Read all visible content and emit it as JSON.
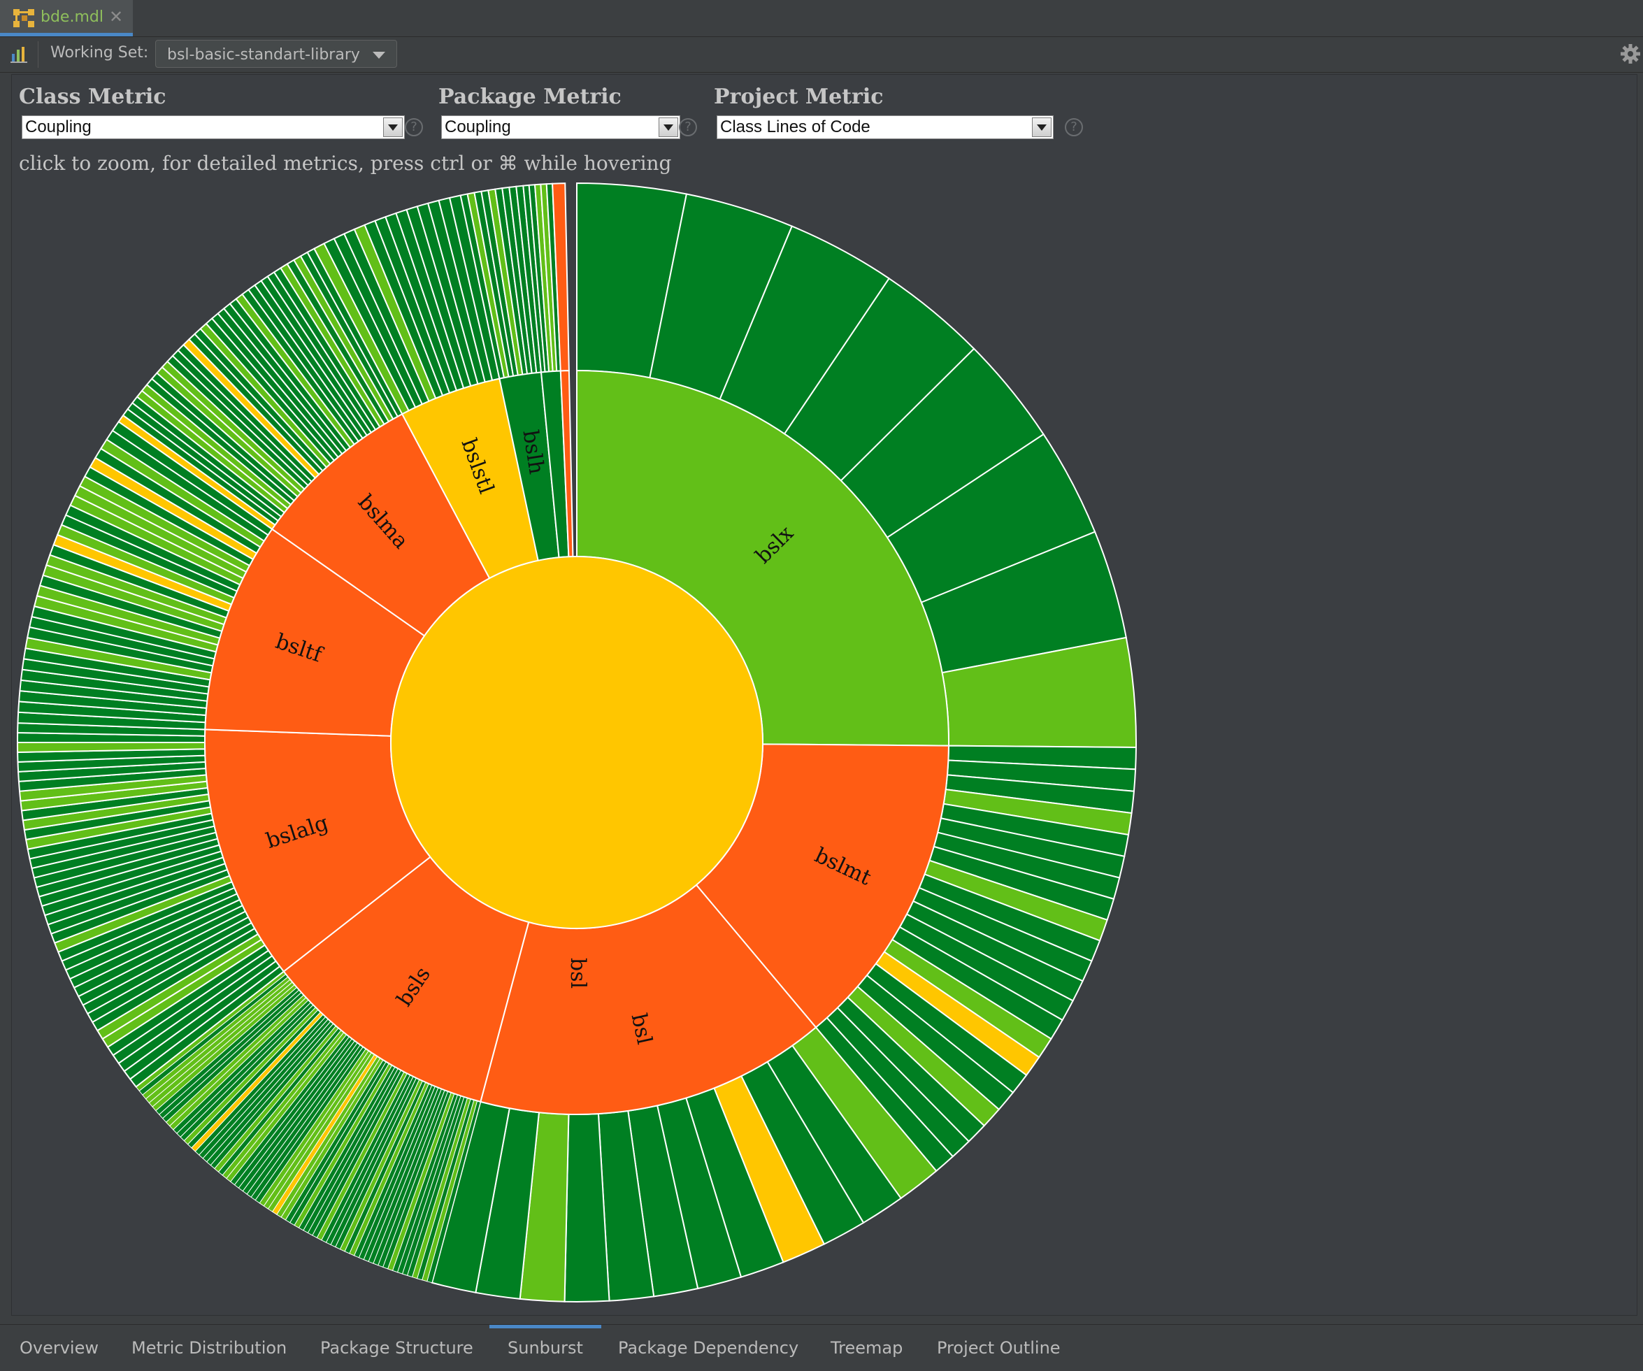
{
  "file_tab": {
    "name": "bde.mdl",
    "close": "✕"
  },
  "toolbar": {
    "working_set_label": "Working Set:",
    "working_set_value": "bsl-basic-standart-library"
  },
  "metrics": {
    "class": {
      "title": "Class Metric",
      "value": "Coupling"
    },
    "package": {
      "title": "Package Metric",
      "value": "Coupling"
    },
    "project": {
      "title": "Project Metric",
      "value": "Class Lines of Code"
    },
    "help": "?"
  },
  "hint": "click to zoom, for detailed metrics, press ctrl or ⌘ while hovering",
  "colors": {
    "yellow": "#ffc600",
    "orange": "#ff5c14",
    "lime": "#62bf18",
    "green": "#007f22",
    "accent": "#4a88c7"
  },
  "sunburst": {
    "root": {
      "label": "bsl",
      "color": "yellow"
    },
    "packages": [
      {
        "label": "bslx",
        "color": "lime"
      },
      {
        "label": "bslmt",
        "color": "orange"
      },
      {
        "label": "bsl",
        "color": "orange"
      },
      {
        "label": "bsls",
        "color": "orange"
      },
      {
        "label": "bslalg",
        "color": "orange"
      },
      {
        "label": "bsltf",
        "color": "orange"
      },
      {
        "label": "bslma",
        "color": "orange"
      },
      {
        "label": "bslstl",
        "color": "yellow"
      },
      {
        "label": "bslh",
        "color": "green"
      },
      {
        "label": "",
        "color": "green"
      },
      {
        "label": "",
        "color": "orange"
      }
    ]
  },
  "bottom_tabs": [
    {
      "label": "Overview",
      "active": false
    },
    {
      "label": "Metric Distribution",
      "active": false
    },
    {
      "label": "Package Structure",
      "active": false
    },
    {
      "label": "Sunburst",
      "active": true
    },
    {
      "label": "Package Dependency",
      "active": false
    },
    {
      "label": "Treemap",
      "active": false
    },
    {
      "label": "Project Outline",
      "active": false
    }
  ]
}
